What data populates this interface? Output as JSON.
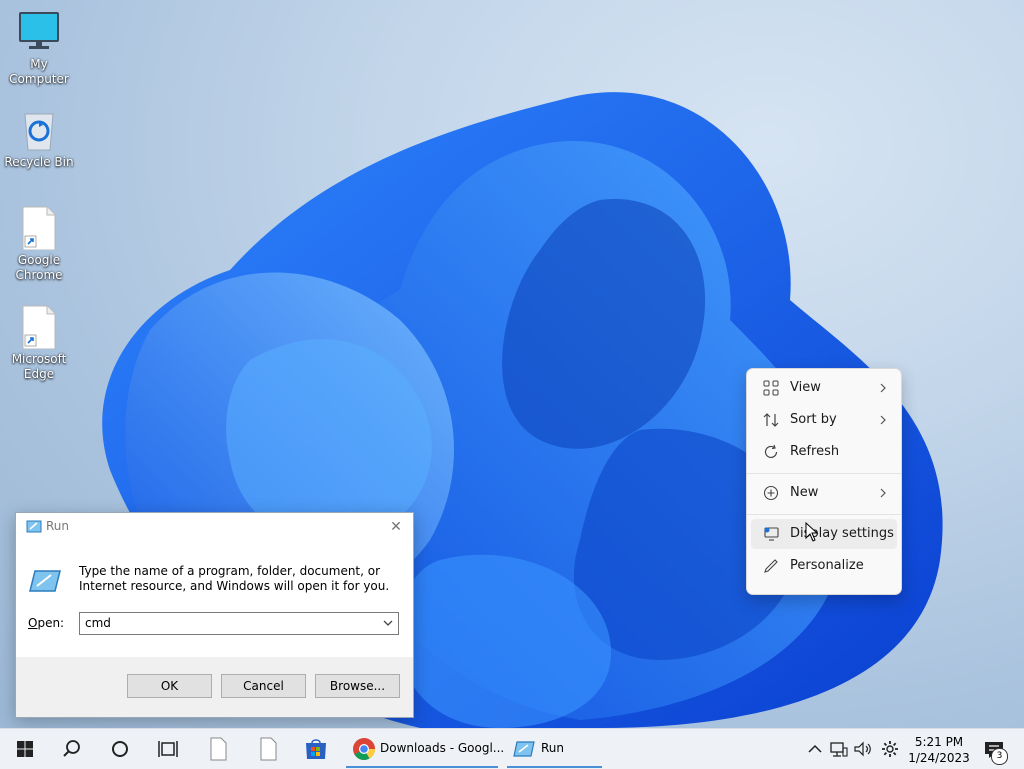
{
  "desktop": {
    "icons": [
      {
        "label": "My Computer",
        "icon": "monitor-icon"
      },
      {
        "label": "Recycle Bin",
        "icon": "recycle-bin-icon"
      },
      {
        "label": "Google Chrome",
        "icon": "shortcut-file-icon"
      },
      {
        "label": "Microsoft Edge",
        "icon": "shortcut-file-icon"
      }
    ]
  },
  "run_dialog": {
    "title": "Run",
    "description": "Type the name of a program, folder, document, or Internet resource, and Windows will open it for you.",
    "open_label": "Open:",
    "open_value": "cmd",
    "buttons": {
      "ok": "OK",
      "cancel": "Cancel",
      "browse": "Browse..."
    }
  },
  "context_menu": {
    "items": [
      {
        "label": "View",
        "icon": "grid-icon",
        "submenu": true
      },
      {
        "label": "Sort by",
        "icon": "sort-icon",
        "submenu": true
      },
      {
        "label": "Refresh",
        "icon": "refresh-icon",
        "submenu": false
      },
      {
        "label": "New",
        "icon": "plus-circle-icon",
        "submenu": true
      },
      {
        "label": "Display settings",
        "icon": "display-settings-icon",
        "submenu": false
      },
      {
        "label": "Personalize",
        "icon": "pen-icon",
        "submenu": false
      }
    ]
  },
  "taskbar": {
    "apps": [
      {
        "label": "Downloads - Googl...",
        "icon": "chrome-icon"
      },
      {
        "label": "Run",
        "icon": "run-icon"
      }
    ],
    "clock": {
      "time": "5:21 PM",
      "date": "1/24/2023"
    },
    "notification_count": "3"
  },
  "colors": {
    "accent": "#1f6fd6",
    "taskbar": "#eef1f6",
    "dialog_footer": "#f0f0f0"
  }
}
